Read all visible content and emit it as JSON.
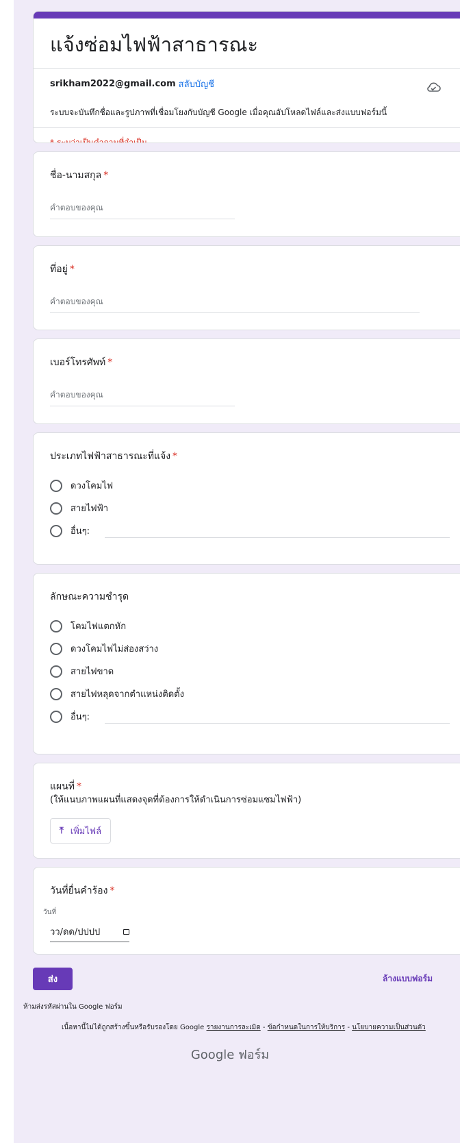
{
  "form": {
    "title": "แจ้งซ่อมไฟฟ้าสาธารณะ",
    "account_email": "srikham2022@gmail.com",
    "switch_account": "สลับบัญชี",
    "notice": "ระบบจะบันทึกชื่อและรูปภาพที่เชื่อมโยงกับบัญชี Google เมื่อคุณอัปโหลดไฟล์และส่งแบบฟอร์มนี้",
    "required_note": "* ระบุว่าเป็นคำถามที่จำเป็น"
  },
  "questions": {
    "name": {
      "label": "ชื่อ-นามสกุล",
      "required": "*",
      "placeholder": "คำตอบของคุณ"
    },
    "address": {
      "label": "ที่อยู่",
      "required": "*",
      "placeholder": "คำตอบของคุณ"
    },
    "phone": {
      "label": "เบอร์โทรศัพท์",
      "required": "*",
      "placeholder": "คำตอบของคุณ"
    },
    "type": {
      "label": "ประเภทไฟฟ้าสาธารณะที่แจ้ง",
      "required": "*",
      "options": [
        "ดวงโคมไฟ",
        "สายไฟฟ้า",
        "อื่นๆ:"
      ]
    },
    "damage": {
      "label": "ลักษณะความชำรุด",
      "options": [
        "โคมไฟแตกหัก",
        "ดวงโคมไฟไม่ส่องสว่าง",
        "สายไฟขาด",
        "สายไฟหลุดจากตำแหน่งติดตั้ง",
        "อื่นๆ:"
      ]
    },
    "map": {
      "label": "แผนที่",
      "required": "*",
      "description": "(ให้แนบภาพแผนที่แสดงจุดที่ต้องการให้ดำเนินการซ่อมแซมไฟฟ้า)",
      "upload": "เพิ่มไฟล์"
    },
    "date": {
      "label": "วันที่ยื่นคำร้อง",
      "required": "*",
      "sub_label": "วันที่",
      "placeholder": "วว/ดด/ปปปป"
    }
  },
  "actions": {
    "submit": "ส่ง",
    "clear": "ล้างแบบฟอร์ม"
  },
  "footer": {
    "never_passwords": "ห้ามส่งรหัสผ่านใน Google ฟอร์ม",
    "disclaimer": "เนื้อหานี้ไม่ได้ถูกสร้างขึ้นหรือรับรองโดย Google",
    "report": "รายงานการละเมิด",
    "terms": "ข้อกำหนดในการให้บริการ",
    "privacy": "นโยบายความเป็นส่วนตัว",
    "sep": " - ",
    "brand_google": "Google",
    "brand_forms": "ฟอร์ม"
  },
  "colors": {
    "accent": "#673ab7",
    "required": "#d93025",
    "link": "#1a73e8"
  },
  "icons": {
    "cloud": "cloud-check-icon",
    "upload": "upload-icon",
    "calendar": "calendar-icon"
  }
}
